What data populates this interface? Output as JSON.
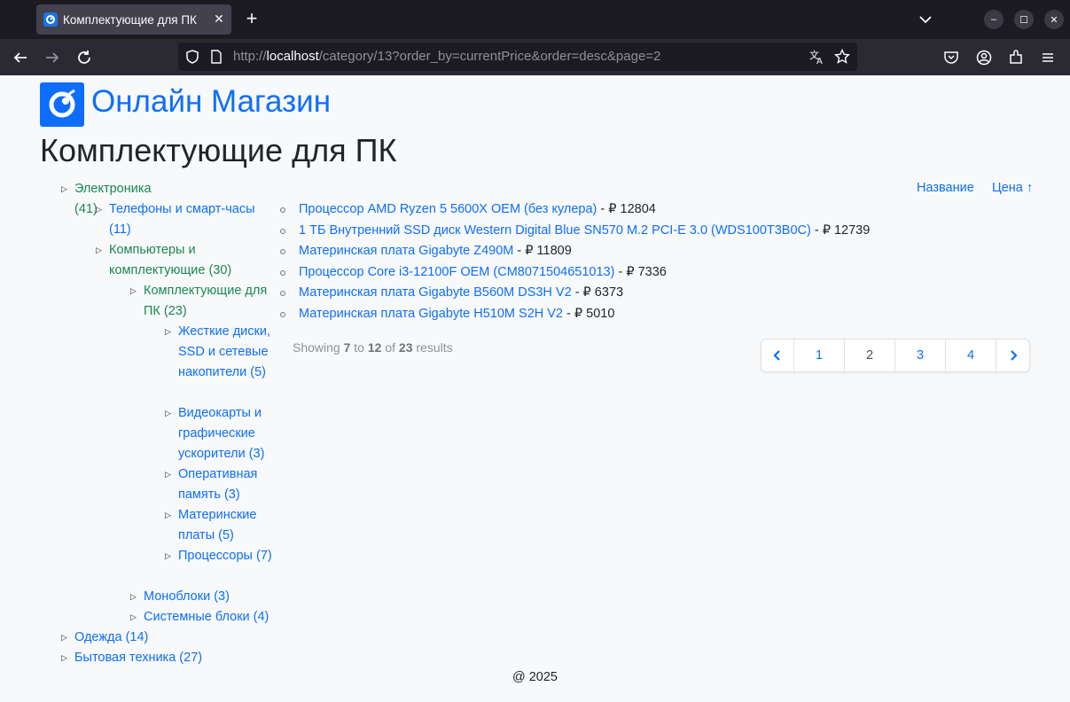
{
  "browser": {
    "tab_title": "Комплектующие для ПК",
    "url_prefix": "http://",
    "url_host": "localhost",
    "url_path": "/category/13?order_by=currentPrice&order=desc&page=2"
  },
  "site": {
    "name": "Онлайн Магазин",
    "page_title": "Комплектующие для ПК"
  },
  "categories": {
    "electronics": "Электроника (41)",
    "phones": "Телефоны и смарт-часы (11)",
    "computers": "Компьютеры и комплектующие (30)",
    "pc_parts": "Комплектующие для ПК (23)",
    "drives": "Жесткие диски, SSD и сетевые накопители (5)",
    "gpus": "Видеокарты и графические ускорители (3)",
    "ram": "Оперативная память (3)",
    "motherboards": "Материнские платы (5)",
    "cpus": "Процессоры (7)",
    "monoblocks": "Моноблоки (3)",
    "system_units": "Системные блоки (4)",
    "clothing": "Одежда (14)",
    "appliances": "Бытовая техника (27)"
  },
  "sort": {
    "by_name": "Название",
    "by_price": "Цена ↑"
  },
  "products": [
    {
      "name": "Процессор AMD Ryzen 5 5600X OEM (без кулера)",
      "price": " - ₽ 12804"
    },
    {
      "name": "1 ТБ Внутренний SSD диск Western Digital Blue SN570 M.2 PCI-E 3.0 (WDS100T3B0C)",
      "price": " - ₽ 12739"
    },
    {
      "name": "Материнская плата Gigabyte Z490M",
      "price": " - ₽ 11809"
    },
    {
      "name": "Процессор Core i3-12100F OEM (CM8071504651013)",
      "price": " - ₽ 7336"
    },
    {
      "name": "Материнская плата Gigabyte B560M DS3H V2",
      "price": " - ₽ 6373"
    },
    {
      "name": "Материнская плата Gigabyte H510M S2H V2",
      "price": " - ₽ 5010"
    }
  ],
  "results": {
    "showing": "Showing",
    "from": "7",
    "to_word": "to",
    "to": "12",
    "of_word": "of",
    "total": "23",
    "results_word": "results"
  },
  "pagination": {
    "pages": [
      "1",
      "2",
      "3",
      "4"
    ],
    "current_page": "2"
  },
  "footer": "@ 2025",
  "colors": {
    "link": "#0d6efd",
    "active_category": "#198754",
    "browser_bg": "#1c1b22"
  }
}
